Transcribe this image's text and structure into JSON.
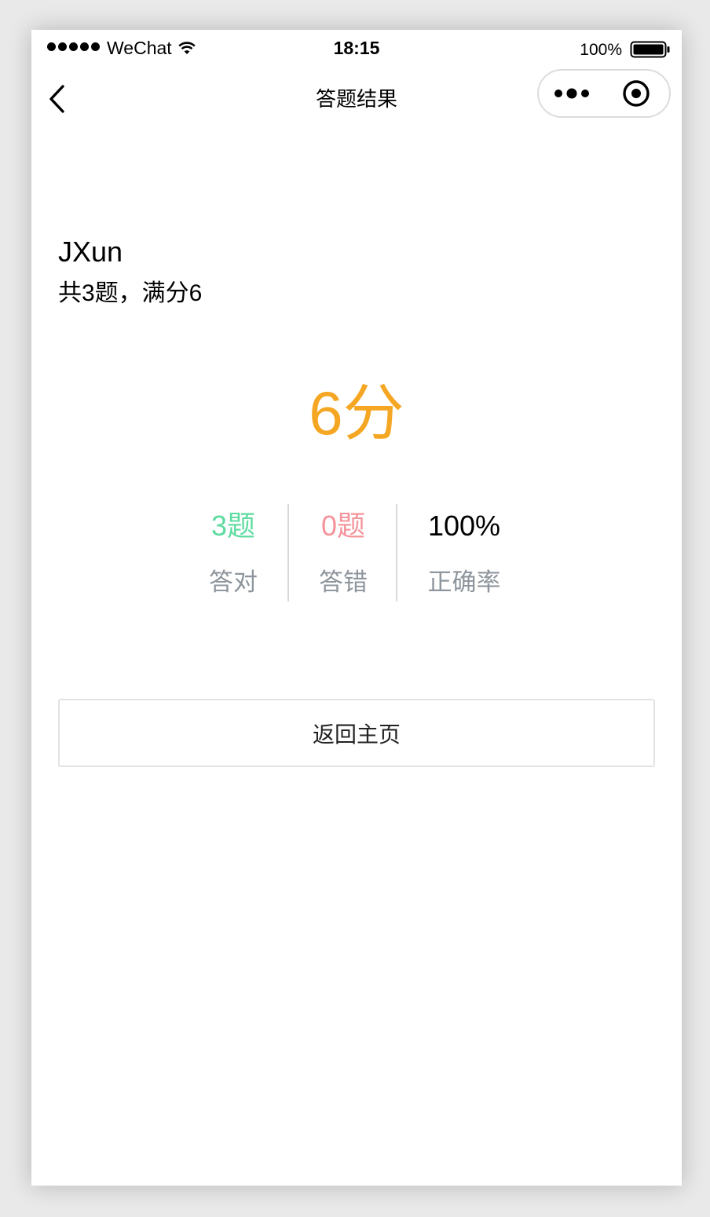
{
  "status_bar": {
    "carrier": "WeChat",
    "time": "18:15",
    "battery": "100%"
  },
  "nav": {
    "title": "答题结果",
    "icons": [
      "back-arrow-icon",
      "more-dots-icon",
      "close-target-icon"
    ]
  },
  "result": {
    "user_name": "JXun",
    "summary": "共3题，满分6",
    "score": "6分",
    "stats": {
      "correct_value": "3题",
      "correct_label": "答对",
      "wrong_value": "0题",
      "wrong_label": "答错",
      "rate_value": "100%",
      "rate_label": "正确率"
    },
    "home_button": "返回主页"
  },
  "colors": {
    "score": "#f5a623",
    "correct": "#5ddca0",
    "wrong": "#f4949a",
    "rate": "#000000",
    "label": "#8e959c"
  }
}
